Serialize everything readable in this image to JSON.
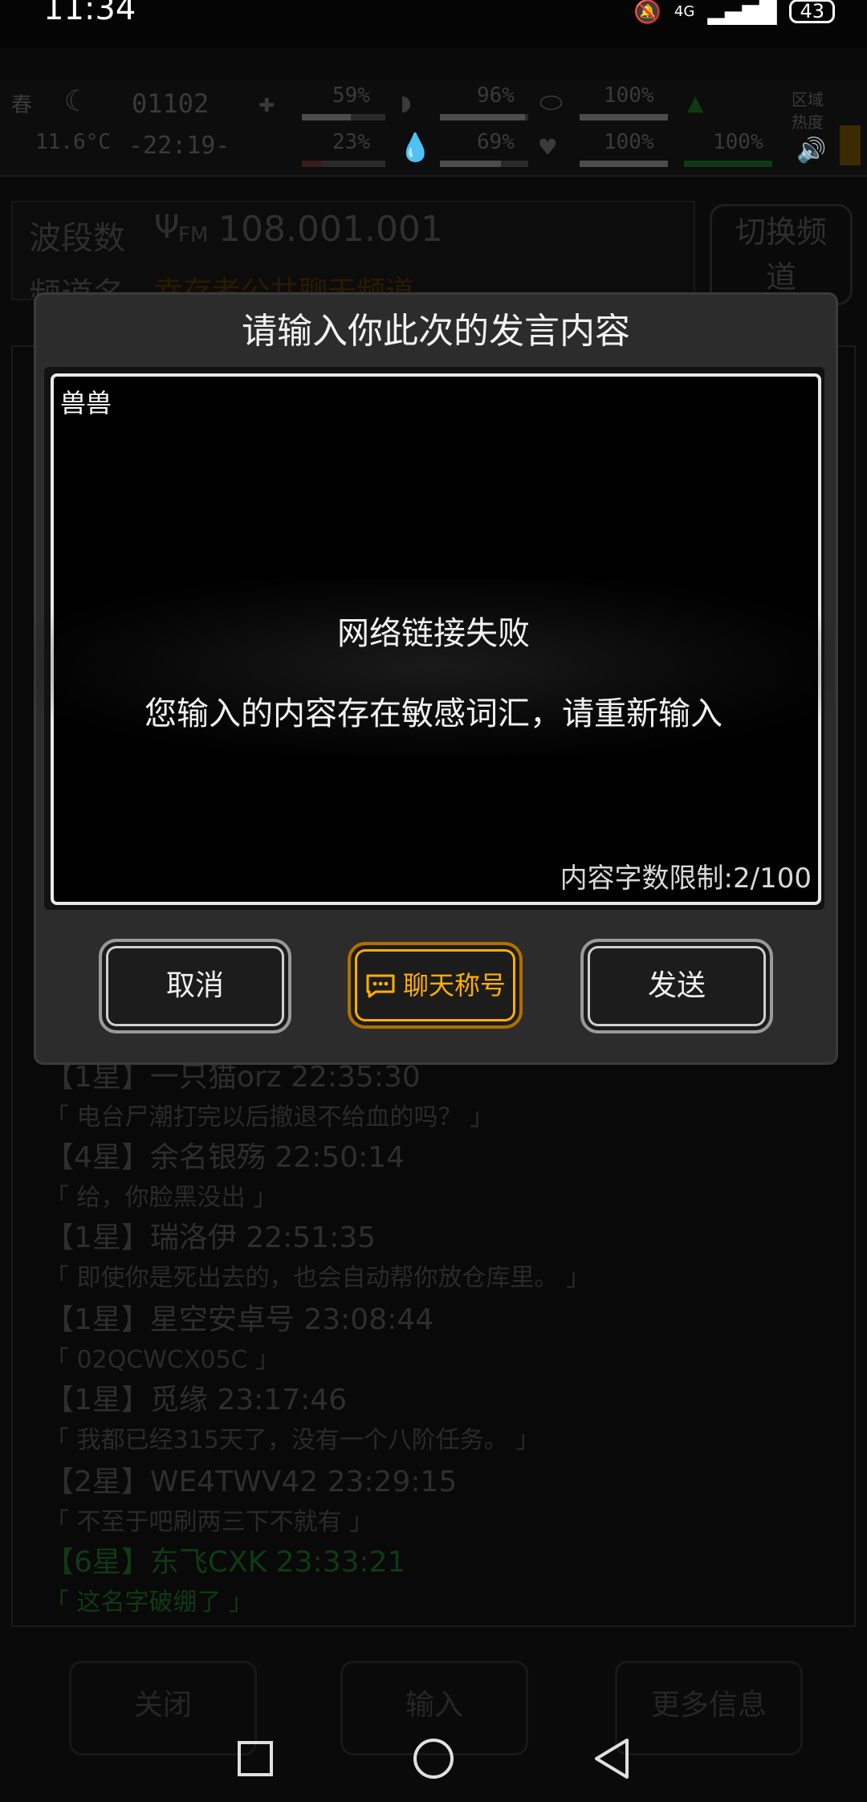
{
  "status": {
    "time": "11:34",
    "battery": "43",
    "network": "4G"
  },
  "hud": {
    "season": "春",
    "temperature": "11.6°C",
    "day": "01102",
    "clock": "-22:19-",
    "stats": [
      {
        "value": "59%",
        "fraction": 0.59
      },
      {
        "value": "23%",
        "fraction": 0.23
      },
      {
        "value": "96%",
        "fraction": 0.96
      },
      {
        "value": "69%",
        "fraction": 0.69
      },
      {
        "value": "100%",
        "fraction": 1.0
      },
      {
        "value": "100%",
        "fraction": 1.0
      },
      {
        "value": "100%",
        "fraction": 1.0
      }
    ],
    "zone_label": "区域热度"
  },
  "channel": {
    "band_label": "波段数",
    "band_value": "108.001.001",
    "band_prefix": "FM",
    "name_label": "频道名",
    "name_value": "幸存者公共聊天频道",
    "switch_button": "切换频道"
  },
  "chat": [
    {
      "header": "【1星】一只猫orz 22:35:30",
      "text": "「 电台尸潮打完以后撤退不给血的吗？ 」",
      "green": false
    },
    {
      "header": "【4星】余名银殇 22:50:14",
      "text": "「 给，你脸黑没出 」",
      "green": false
    },
    {
      "header": "【1星】瑞洛伊 22:51:35",
      "text": "「 即使你是死出去的，也会自动帮你放仓库里。 」",
      "green": false
    },
    {
      "header": "【1星】星空安卓号 23:08:44",
      "text": "「 02QCWCX05C 」",
      "green": false
    },
    {
      "header": "【1星】觅缘 23:17:46",
      "text": "「 我都已经315天了，没有一个八阶任务。 」",
      "green": false
    },
    {
      "header": "【2星】WE4TWV42 23:29:15",
      "text": "「 不至于吧刷两三下不就有 」",
      "green": false
    },
    {
      "header": "【6星】东飞CXK 23:33:21",
      "text": "「 这名字破绷了 」",
      "green": true
    }
  ],
  "bottom": {
    "close": "关闭",
    "input": "输入",
    "more": "更多信息"
  },
  "dialog": {
    "title": "请输入你此次的发言内容",
    "input_value": "兽兽",
    "char_limit": "内容字数限制:2/100",
    "cancel": "取消",
    "chat_title": "聊天称号",
    "send": "发送"
  },
  "toast": {
    "title": "网络链接失败",
    "message": "您输入的内容存在敏感词汇，请重新输入"
  },
  "colors": {
    "accent": "#ffae00",
    "dialog_bg": "#2c2c2c",
    "chat_green": "#0f3a14"
  }
}
